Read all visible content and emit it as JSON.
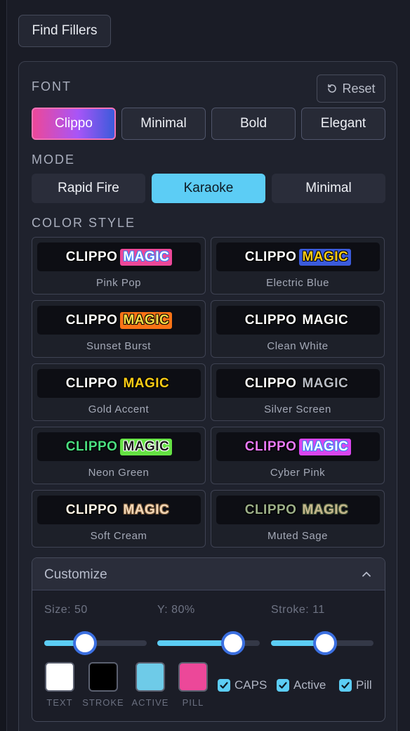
{
  "find_fillers_label": "Find Fillers",
  "font": {
    "label": "FONT",
    "reset_label": "Reset",
    "options": [
      "Clippo",
      "Minimal",
      "Bold",
      "Elegant"
    ],
    "selected": "Clippo"
  },
  "mode": {
    "label": "MODE",
    "options": [
      "Rapid Fire",
      "Karaoke",
      "Minimal"
    ],
    "selected": "Karaoke"
  },
  "color_style": {
    "label": "COLOR STYLE",
    "preview_word1": "CLIPPO",
    "preview_word2": "MAGIC",
    "styles": [
      {
        "name": "Pink Pop",
        "word1_color": "#ffffff",
        "word2_color": "#ffffff",
        "word2_bg": "#ec4899",
        "word2_stroke": "#3b82f6"
      },
      {
        "name": "Electric Blue",
        "word1_color": "#ffffff",
        "word2_color": "#facc15",
        "word2_bg": "#3b5bdb",
        "word2_stroke": "#000000"
      },
      {
        "name": "Sunset Burst",
        "word1_color": "#ffffff",
        "word2_color": "#fde047",
        "word2_bg": "#f97316",
        "word2_stroke": "#000000"
      },
      {
        "name": "Clean White",
        "word1_color": "#ffffff",
        "word2_color": "#ffffff",
        "word2_bg": "",
        "word2_stroke": "#000000"
      },
      {
        "name": "Gold Accent",
        "word1_color": "#ffffff",
        "word2_color": "#facc15",
        "word2_bg": "",
        "word2_stroke": "#000000"
      },
      {
        "name": "Silver Screen",
        "word1_color": "#ffffff",
        "word2_color": "#b8bcc5",
        "word2_bg": "",
        "word2_stroke": "#000000"
      },
      {
        "name": "Neon Green",
        "word1_color": "#4ade80",
        "word2_color": "#1a1a1a",
        "word2_bg": "#65e244",
        "word2_stroke": "#ffffff"
      },
      {
        "name": "Cyber Pink",
        "word1_color": "#e879f9",
        "word2_color": "#ffffff",
        "word2_bg": "#d946ef",
        "word2_stroke": "#3b82f6"
      },
      {
        "name": "Soft Cream",
        "word1_color": "#fff5e6",
        "word2_color": "#f5d9b8",
        "word2_bg": "",
        "word2_stroke": "#7a5a3a"
      },
      {
        "name": "Muted Sage",
        "word1_color": "#9caf88",
        "word2_color": "#c7b88e",
        "word2_bg": "",
        "word2_stroke": "#4a5a3a"
      }
    ]
  },
  "customize": {
    "title": "Customize",
    "sliders": [
      {
        "label": "Size: 50",
        "fraction": 0.4
      },
      {
        "label": "Y: 80%",
        "fraction": 0.74
      },
      {
        "label": "Stroke: 11",
        "fraction": 0.53
      }
    ],
    "swatches": [
      {
        "label": "TEXT",
        "color": "#ffffff"
      },
      {
        "label": "STROKE",
        "color": "#000000"
      },
      {
        "label": "ACTIVE",
        "color": "#6ecbe8"
      },
      {
        "label": "PILL",
        "color": "#ec4899"
      }
    ],
    "checkboxes": [
      {
        "label": "CAPS",
        "checked": true
      },
      {
        "label": "Active",
        "checked": true
      },
      {
        "label": "Pill",
        "checked": true
      }
    ]
  },
  "colors": {
    "accent": "#5ccdf5",
    "thumb_border": "#3b6fe0"
  }
}
